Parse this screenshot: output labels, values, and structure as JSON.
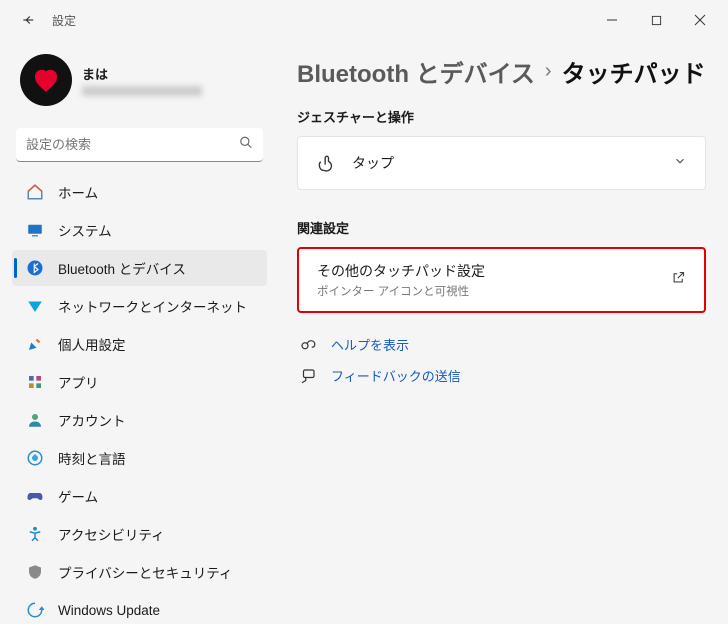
{
  "window": {
    "title": "設定"
  },
  "profile": {
    "name": "まは",
    "sub": ""
  },
  "search": {
    "placeholder": "設定の検索"
  },
  "nav": {
    "home": "ホーム",
    "system": "システム",
    "bluetooth": "Bluetooth とデバイス",
    "network": "ネットワークとインターネット",
    "personalization": "個人用設定",
    "apps": "アプリ",
    "accounts": "アカウント",
    "time": "時刻と言語",
    "gaming": "ゲーム",
    "accessibility": "アクセシビリティ",
    "privacy": "プライバシーとセキュリティ",
    "update": "Windows Update"
  },
  "breadcrumb": {
    "parent": "Bluetooth とデバイス",
    "current": "タッチパッド"
  },
  "sections": {
    "gestures": "ジェスチャーと操作",
    "related": "関連設定"
  },
  "tap": {
    "title": "タップ"
  },
  "other": {
    "title": "その他のタッチパッド設定",
    "sub": "ポインター アイコンと可視性"
  },
  "links": {
    "help": "ヘルプを表示",
    "feedback": "フィードバックの送信"
  }
}
